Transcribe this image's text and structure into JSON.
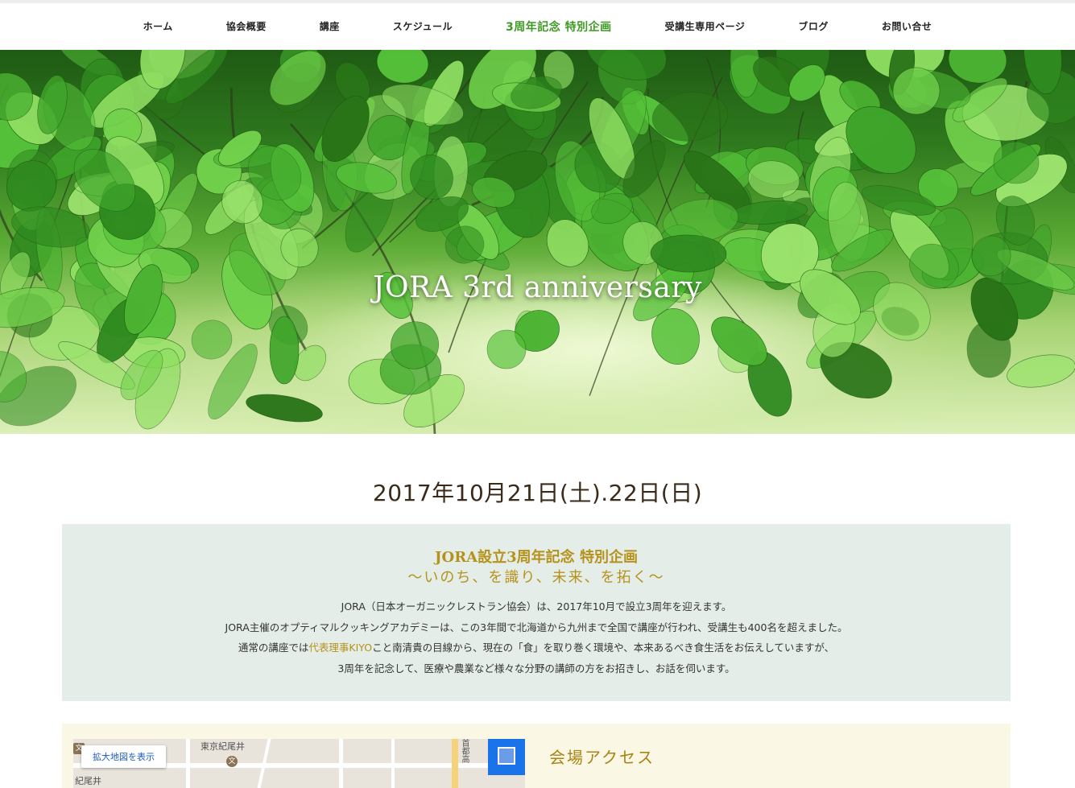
{
  "nav": {
    "items": [
      {
        "label": "ホーム"
      },
      {
        "label": "協会概要"
      },
      {
        "label": "講座"
      },
      {
        "label": "スケジュール"
      },
      {
        "label": "3周年記念 特別企画"
      },
      {
        "label": "受講生専用ページ"
      },
      {
        "label": "ブログ"
      },
      {
        "label": "お問い合せ"
      }
    ]
  },
  "hero": {
    "title": "JORA 3rd anniversary"
  },
  "event": {
    "date": "2017年10月21日(土).22日(日)"
  },
  "intro": {
    "heading": "JORA設立3周年記念 特別企画",
    "subheading": "〜いのち、を識り、未来、を拓く〜",
    "p1": "JORA（日本オーガニックレストラン協会）は、2017年10月で設立3周年を迎えます。",
    "p2": "JORA主催のオプティマルクッキングアカデミーは、この3年間で北海道から九州まで全国で講座が行われ、受講生も400名を超えました。",
    "p3_pre": "通常の講座では",
    "p3_link": "代表理事KIYO",
    "p3_post": "こと南清貴の目線から、現在の「食」を取り巻く環境や、本来あるべき食生活をお伝えしていますが、",
    "p4": "3周年を記念して、医療や農業など様々な分野の講師の方をお招きし、お話を伺います。"
  },
  "access": {
    "heading": "会場アクセス",
    "map_button": "拡大地図を表示",
    "map_labels": [
      "東京紀尾井",
      "紀尾井",
      "首都高"
    ],
    "colors": {
      "accent": "#b5921c",
      "map_pin_panel": "#1a73e8"
    }
  },
  "colors": {
    "nav_active": "#3f9a24",
    "intro_bg": "#e5ede8",
    "access_bg": "#fbf7e5"
  }
}
